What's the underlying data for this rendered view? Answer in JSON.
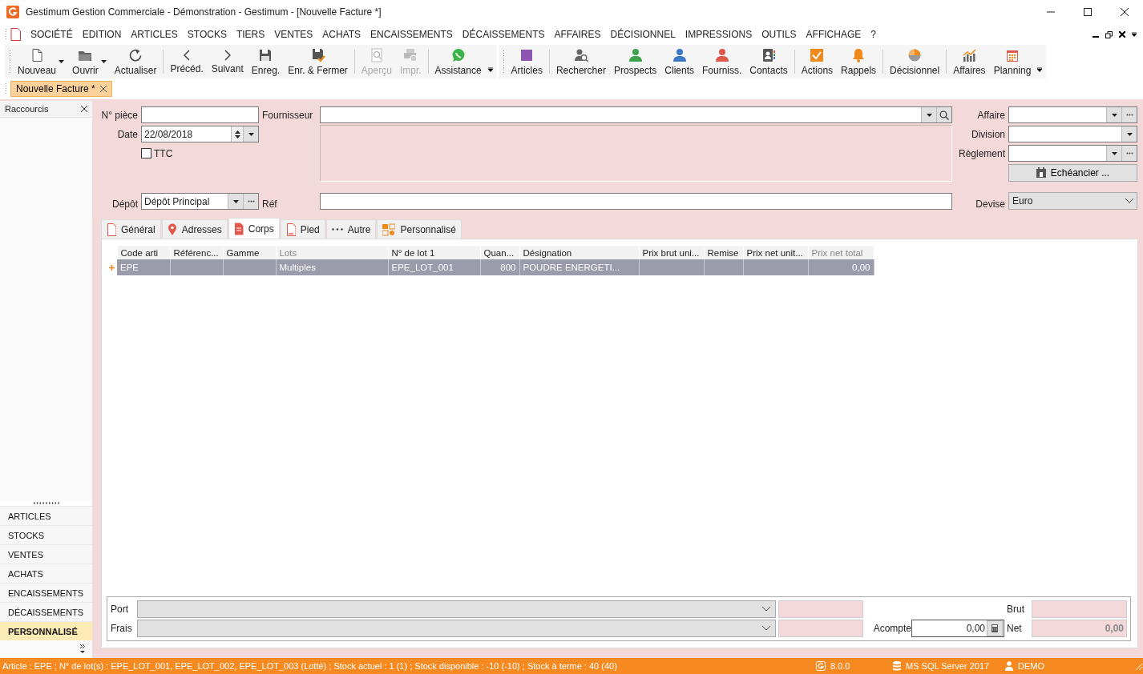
{
  "window": {
    "title": "Gestimum Gestion Commerciale - Démonstration - Gestimum - [Nouvelle Facture *]"
  },
  "menu": [
    "SOCIÉTÉ",
    "EDITION",
    "ARTICLES",
    "STOCKS",
    "TIERS",
    "VENTES",
    "ACHATS",
    "ENCAISSEMENTS",
    "DÉCAISSEMENTS",
    "AFFAIRES",
    "DÉCISIONNEL",
    "IMPRESSIONS",
    "OUTILS",
    "AFFICHAGE",
    "?"
  ],
  "toolbars": [
    {
      "groups": [
        [
          {
            "label": "Nouveau",
            "disabled": false,
            "has_menu": true
          },
          {
            "label": "Ouvrir",
            "disabled": false,
            "has_menu": true
          },
          {
            "label": "Actualiser",
            "disabled": false,
            "has_menu": false
          }
        ],
        [
          {
            "label": "Précéd.",
            "disabled": false,
            "has_menu": false
          },
          {
            "label": "Suivant",
            "disabled": false,
            "has_menu": false
          },
          {
            "label": "Enreg.",
            "disabled": false,
            "has_menu": false
          },
          {
            "label": "Enr. & Fermer",
            "disabled": false,
            "has_menu": false
          }
        ],
        [
          {
            "label": "Aperçu",
            "disabled": true,
            "has_menu": false
          },
          {
            "label": "Impr.",
            "disabled": true,
            "has_menu": false
          }
        ],
        [
          {
            "label": "Assistance",
            "disabled": false,
            "has_menu": false
          }
        ]
      ]
    },
    {
      "groups": [
        [
          {
            "label": "Articles",
            "disabled": false,
            "has_menu": false
          }
        ],
        [
          {
            "label": "Rechercher",
            "disabled": false,
            "has_menu": false
          },
          {
            "label": "Prospects",
            "disabled": false,
            "has_menu": false
          },
          {
            "label": "Clients",
            "disabled": false,
            "has_menu": false
          },
          {
            "label": "Fourniss.",
            "disabled": false,
            "has_menu": false
          },
          {
            "label": "Contacts",
            "disabled": false,
            "has_menu": false
          }
        ],
        [
          {
            "label": "Actions",
            "disabled": false,
            "has_menu": false
          },
          {
            "label": "Rappels",
            "disabled": false,
            "has_menu": false
          }
        ],
        [
          {
            "label": "Décisionnel",
            "disabled": false,
            "has_menu": false
          }
        ],
        [
          {
            "label": "Affaires",
            "disabled": false,
            "has_menu": false
          },
          {
            "label": "Planning",
            "disabled": false,
            "has_menu": false
          }
        ]
      ]
    }
  ],
  "doc_tabs": [
    {
      "label": "Nouvelle Facture *",
      "selected": true
    }
  ],
  "sidebar": {
    "title": "Raccourcis",
    "items": [
      {
        "label": "ARTICLES",
        "selected": false
      },
      {
        "label": "STOCKS",
        "selected": false
      },
      {
        "label": "VENTES",
        "selected": false
      },
      {
        "label": "ACHATS",
        "selected": false
      },
      {
        "label": "ENCAISSEMENTS",
        "selected": false
      },
      {
        "label": "DÉCAISSEMENTS",
        "selected": false
      },
      {
        "label": "PERSONNALISÉ",
        "selected": true
      }
    ]
  },
  "header": {
    "numero_piece": {
      "label": "N° pièce"
    },
    "date": {
      "label": "Date",
      "value": "22/08/2018"
    },
    "ttc": {
      "label": "TTC",
      "checked": false
    },
    "fournisseur": {
      "label": "Fournisseur"
    },
    "affaire": {
      "label": "Affaire"
    },
    "division": {
      "label": "Division"
    },
    "reglement": {
      "label": "Règlement"
    },
    "echeancier": {
      "label": "Echéancier ..."
    },
    "depot": {
      "label": "Dépôt",
      "value": "Dépôt Principal"
    },
    "ref": {
      "label": "Réf"
    },
    "devise": {
      "label": "Devise",
      "value": "Euro"
    }
  },
  "tabs": [
    {
      "label": "Général",
      "selected": false
    },
    {
      "label": "Adresses",
      "selected": false
    },
    {
      "label": "Corps",
      "selected": true
    },
    {
      "label": "Pied",
      "selected": false
    },
    {
      "label": "Autre",
      "selected": false
    },
    {
      "label": "Personnalisé",
      "selected": false
    }
  ],
  "grid": {
    "columns": [
      {
        "label": "Code arti",
        "readonly": false
      },
      {
        "label": "Référenc...",
        "readonly": false
      },
      {
        "label": "Gamme",
        "readonly": false
      },
      {
        "label": "Lots",
        "readonly": true
      },
      {
        "label": "N° de lot 1",
        "readonly": false
      },
      {
        "label": "Quan...",
        "readonly": false
      },
      {
        "label": "Désignation",
        "readonly": false
      },
      {
        "label": "Prix brut uni...",
        "readonly": false
      },
      {
        "label": "Remise",
        "readonly": false
      },
      {
        "label": "Prix net unit...",
        "readonly": false
      },
      {
        "label": "Prix net total",
        "readonly": true
      }
    ],
    "rows": [
      {
        "selected": true,
        "cells": [
          "EPE",
          null,
          null,
          "Multiples",
          "EPE_LOT_001",
          "800",
          "POUDRE ENERGETI...",
          null,
          null,
          null,
          "0,00"
        ]
      }
    ]
  },
  "footer": {
    "port": {
      "label": "Port"
    },
    "frais": {
      "label": "Frais"
    },
    "acompte": {
      "label": "Acompte",
      "value": "0,00"
    },
    "brut": {
      "label": "Brut"
    },
    "net": {
      "label": "Net",
      "value": "0,00"
    }
  },
  "status_bar": {
    "message": "Article : EPE ; N° de lot(s) : EPE_LOT_001, EPE_LOT_002, EPE_LOT_003 (Lotté) ; Stock actuel : 1 (1) ; Stock disponible : -10 (-10) ; Stock à terme : 40 (40)",
    "version": "8.0.0",
    "database": "MS SQL Server 2017",
    "user": "DEMO"
  }
}
